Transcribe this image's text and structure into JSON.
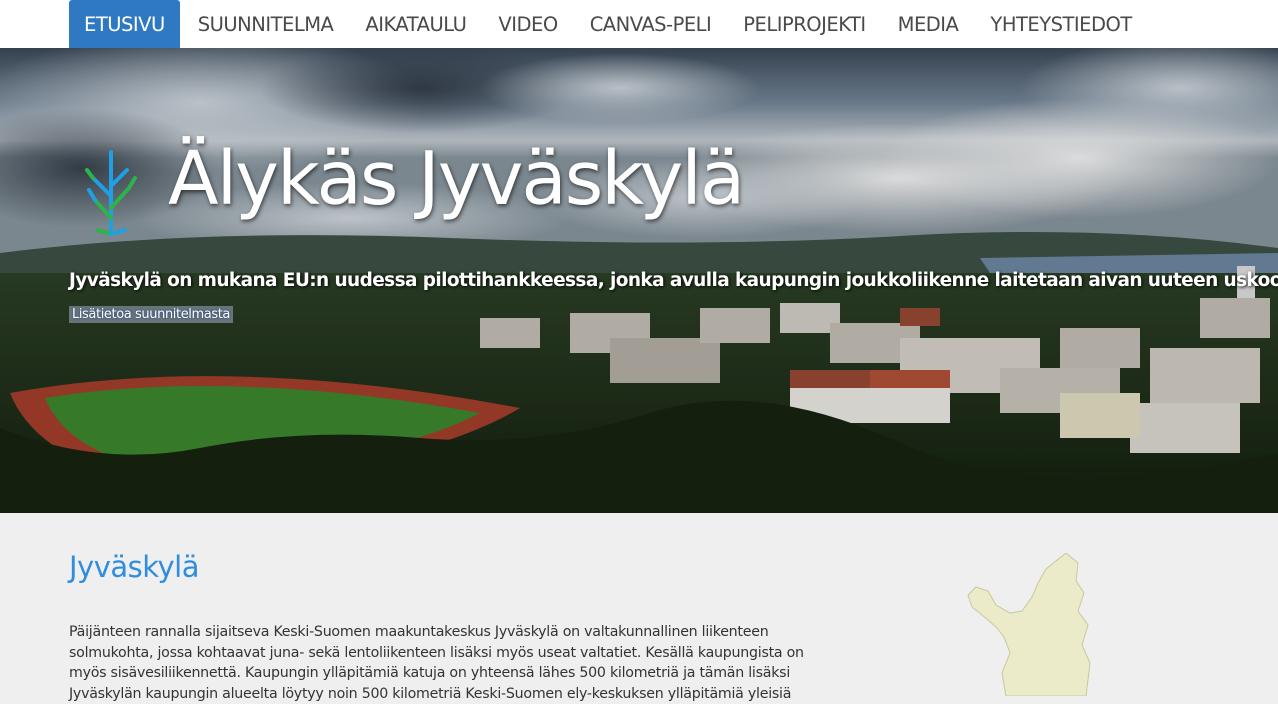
{
  "nav": {
    "items": [
      {
        "label": "ETUSIVU",
        "active": true
      },
      {
        "label": "SUUNNITELMA"
      },
      {
        "label": "AIKATAULU"
      },
      {
        "label": "VIDEO"
      },
      {
        "label": "CANVAS-PELI"
      },
      {
        "label": "PELIPROJEKTI"
      },
      {
        "label": "MEDIA"
      },
      {
        "label": "YHTEYSTIEDOT"
      }
    ]
  },
  "hero": {
    "title": "Älykäs Jyväskylä",
    "subtitle": "Jyväskylä on mukana EU:n uudessa pilottihankkeessa, jonka avulla kaupungin joukkoliikenne laitetaan aivan uuteen uskoon.",
    "link_label": "Lisätietoa suunnitelmasta",
    "logo_icon": "tree-logo-icon"
  },
  "main": {
    "heading": "Jyväskylä",
    "paragraph": "Päijänteen rannalla sijaitseva Keski-Suomen maakuntakeskus Jyväskylä on valtakunnallinen liikenteen solmukohta, jossa kohtaavat juna- sekä lentoliikenteen lisäksi myös useat valtatiet. Kesällä kaupungista on myös sisävesiliikennettä. Kaupungin ylläpitämiä katuja on yhteensä lähes 500 kilometriä ja tämän lisäksi Jyväskylän kaupungin alueelta löytyy noin 500 kilometriä Keski-Suomen ely-keskuksen ylläpitämiä yleisiä",
    "map_icon": "finland-map-icon"
  },
  "colors": {
    "accent": "#2f79c2",
    "heading": "#2f8de0",
    "background": "#efefef"
  }
}
